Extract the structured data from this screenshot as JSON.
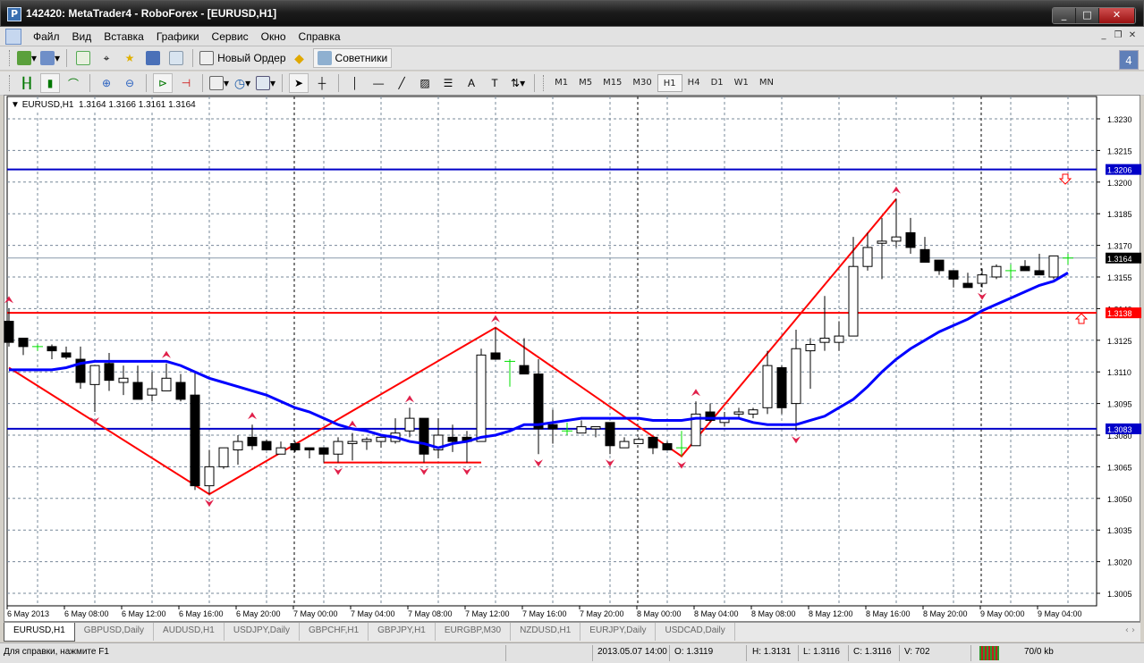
{
  "window": {
    "title": "142420: MetaTrader4 - RoboForex - [EURUSD,H1]",
    "app_icon": "P"
  },
  "menu": [
    "Файл",
    "Вид",
    "Вставка",
    "Графики",
    "Сервис",
    "Окно",
    "Справка"
  ],
  "toolbar": {
    "new_order": "Новый Ордер",
    "experts": "Советники",
    "notifications": "4"
  },
  "timeframes": [
    "M1",
    "M5",
    "M15",
    "M30",
    "H1",
    "H4",
    "D1",
    "W1",
    "MN"
  ],
  "active_timeframe": "H1",
  "chart": {
    "header": "EURUSD,H1  1.3164 1.3166 1.3161 1.3164",
    "colors": {
      "bull": "#ffffff",
      "bear": "#000000",
      "doji": "#00e000",
      "ma": "#0000ff",
      "zigzag": "#ff0000",
      "fractal": "#e0204a",
      "level_blue": "#0000c8",
      "level_red": "#ff0000",
      "bid": "#000000"
    }
  },
  "chart_data": {
    "type": "candlestick",
    "symbol": "EURUSD",
    "timeframe": "H1",
    "ylim": [
      1.2995,
      1.3241
    ],
    "price_ticks": [
      "1.3230",
      "1.3215",
      "1.3200",
      "1.3185",
      "1.3170",
      "1.3155",
      "1.3140",
      "1.3125",
      "1.3110",
      "1.3095",
      "1.3080",
      "1.3065",
      "1.3050",
      "1.3035",
      "1.3020",
      "1.3005"
    ],
    "time_labels": [
      "6 May 2013",
      "6 May 08:00",
      "6 May 12:00",
      "6 May 16:00",
      "6 May 20:00",
      "7 May 00:00",
      "7 May 04:00",
      "7 May 08:00",
      "7 May 12:00",
      "7 May 16:00",
      "7 May 20:00",
      "8 May 00:00",
      "8 May 04:00",
      "8 May 08:00",
      "8 May 12:00",
      "8 May 16:00",
      "8 May 20:00",
      "9 May 00:00",
      "9 May 04:00"
    ],
    "ohlc": [
      [
        1.3134,
        1.314,
        1.3122,
        1.3124
      ],
      [
        1.3126,
        1.3126,
        1.3118,
        1.3122
      ],
      [
        1.3122,
        1.3123,
        1.312,
        1.3122
      ],
      [
        1.3122,
        1.3123,
        1.3116,
        1.312
      ],
      [
        1.3119,
        1.3122,
        1.3116,
        1.3117
      ],
      [
        1.3116,
        1.3122,
        1.3102,
        1.3105
      ],
      [
        1.3104,
        1.3113,
        1.3091,
        1.3113
      ],
      [
        1.3114,
        1.3119,
        1.3101,
        1.3106
      ],
      [
        1.3105,
        1.3113,
        1.3099,
        1.3107
      ],
      [
        1.3105,
        1.3113,
        1.3097,
        1.3097
      ],
      [
        1.3099,
        1.311,
        1.3096,
        1.3102
      ],
      [
        1.3101,
        1.3114,
        1.3101,
        1.3107
      ],
      [
        1.3105,
        1.3109,
        1.3096,
        1.3097
      ],
      [
        1.3099,
        1.311,
        1.3054,
        1.3056
      ],
      [
        1.3056,
        1.3073,
        1.3052,
        1.3065
      ],
      [
        1.3065,
        1.3074,
        1.3064,
        1.3074
      ],
      [
        1.3073,
        1.308,
        1.3066,
        1.3077
      ],
      [
        1.3079,
        1.3085,
        1.3073,
        1.3075
      ],
      [
        1.3077,
        1.3078,
        1.3073,
        1.3073
      ],
      [
        1.3071,
        1.3077,
        1.3071,
        1.3074
      ],
      [
        1.3076,
        1.3077,
        1.3072,
        1.3073
      ],
      [
        1.3074,
        1.3074,
        1.3069,
        1.3073
      ],
      [
        1.3074,
        1.3074,
        1.3067,
        1.3071
      ],
      [
        1.3071,
        1.3079,
        1.3067,
        1.3077
      ],
      [
        1.3076,
        1.3081,
        1.3068,
        1.3077
      ],
      [
        1.3077,
        1.3079,
        1.3073,
        1.3078
      ],
      [
        1.3077,
        1.3079,
        1.3074,
        1.3079
      ],
      [
        1.3077,
        1.3088,
        1.3076,
        1.3081
      ],
      [
        1.3082,
        1.3093,
        1.3079,
        1.3088
      ],
      [
        1.3088,
        1.3088,
        1.3067,
        1.3071
      ],
      [
        1.3073,
        1.3088,
        1.3069,
        1.308
      ],
      [
        1.3079,
        1.3085,
        1.3072,
        1.3077
      ],
      [
        1.3079,
        1.3082,
        1.3067,
        1.3077
      ],
      [
        1.3077,
        1.3121,
        1.3077,
        1.3118
      ],
      [
        1.3119,
        1.3131,
        1.3116,
        1.3116
      ],
      [
        1.3115,
        1.3116,
        1.3103,
        1.3115
      ],
      [
        1.3113,
        1.3126,
        1.3109,
        1.3109
      ],
      [
        1.3109,
        1.3116,
        1.3071,
        1.3083
      ],
      [
        1.3085,
        1.3092,
        1.3076,
        1.3083
      ],
      [
        1.3082,
        1.3086,
        1.308,
        1.3082
      ],
      [
        1.3081,
        1.3087,
        1.3081,
        1.3084
      ],
      [
        1.3083,
        1.3084,
        1.3079,
        1.3084
      ],
      [
        1.3086,
        1.3086,
        1.3071,
        1.3075
      ],
      [
        1.3074,
        1.3079,
        1.3074,
        1.3077
      ],
      [
        1.3076,
        1.3079,
        1.3076,
        1.3078
      ],
      [
        1.3079,
        1.3079,
        1.3071,
        1.3074
      ],
      [
        1.3076,
        1.3077,
        1.3073,
        1.3073
      ],
      [
        1.3074,
        1.3082,
        1.307,
        1.3074
      ],
      [
        1.3075,
        1.3096,
        1.3075,
        1.309
      ],
      [
        1.3091,
        1.3095,
        1.3086,
        1.3087
      ],
      [
        1.3086,
        1.3091,
        1.3084,
        1.3088
      ],
      [
        1.309,
        1.3093,
        1.3088,
        1.3091
      ],
      [
        1.309,
        1.3093,
        1.3088,
        1.3092
      ],
      [
        1.3093,
        1.312,
        1.309,
        1.3113
      ],
      [
        1.3112,
        1.3113,
        1.309,
        1.3093
      ],
      [
        1.3095,
        1.313,
        1.3082,
        1.3121
      ],
      [
        1.312,
        1.3126,
        1.3102,
        1.3123
      ],
      [
        1.3124,
        1.3146,
        1.312,
        1.3126
      ],
      [
        1.3124,
        1.3134,
        1.312,
        1.3127
      ],
      [
        1.3127,
        1.3174,
        1.3127,
        1.316
      ],
      [
        1.316,
        1.3176,
        1.3158,
        1.3169
      ],
      [
        1.3171,
        1.3183,
        1.3154,
        1.3172
      ],
      [
        1.3172,
        1.3192,
        1.3169,
        1.3174
      ],
      [
        1.3176,
        1.3183,
        1.3166,
        1.3169
      ],
      [
        1.3168,
        1.3174,
        1.3162,
        1.3162
      ],
      [
        1.3163,
        1.3163,
        1.3156,
        1.3158
      ],
      [
        1.3158,
        1.3158,
        1.315,
        1.3154
      ],
      [
        1.3152,
        1.3157,
        1.315,
        1.315
      ],
      [
        1.3152,
        1.3159,
        1.315,
        1.3156
      ],
      [
        1.3155,
        1.3161,
        1.3154,
        1.316
      ],
      [
        1.3158,
        1.3161,
        1.3154,
        1.3158
      ],
      [
        1.316,
        1.3163,
        1.3158,
        1.3158
      ],
      [
        1.3158,
        1.3166,
        1.3156,
        1.3156
      ],
      [
        1.3155,
        1.3165,
        1.3154,
        1.3165
      ],
      [
        1.3164,
        1.3166,
        1.3161,
        1.3164
      ]
    ],
    "moving_average": [
      1.3111,
      1.3111,
      1.3111,
      1.3111,
      1.3112,
      1.3114,
      1.3115,
      1.3115,
      1.3115,
      1.3115,
      1.3115,
      1.3115,
      1.3113,
      1.311,
      1.3107,
      1.3105,
      1.3103,
      1.3101,
      1.3099,
      1.3096,
      1.3093,
      1.3091,
      1.3088,
      1.3085,
      1.3083,
      1.3082,
      1.308,
      1.3079,
      1.3077,
      1.3076,
      1.3074,
      1.3076,
      1.3077,
      1.3079,
      1.308,
      1.3082,
      1.3085,
      1.3085,
      1.3086,
      1.3087,
      1.3088,
      1.3088,
      1.3088,
      1.3088,
      1.3088,
      1.3087,
      1.3087,
      1.3087,
      1.3088,
      1.3088,
      1.3088,
      1.3088,
      1.3086,
      1.3085,
      1.3085,
      1.3085,
      1.3087,
      1.3089,
      1.3093,
      1.3097,
      1.3103,
      1.311,
      1.3116,
      1.3121,
      1.3125,
      1.3129,
      1.3132,
      1.3135,
      1.3139,
      1.3142,
      1.3145,
      1.3148,
      1.3151,
      1.3153,
      1.3157
    ],
    "zigzag": [
      [
        0,
        1.3112
      ],
      [
        14,
        1.3052
      ],
      [
        34,
        1.3131
      ],
      [
        47,
        1.307
      ],
      [
        62,
        1.3192
      ]
    ],
    "fractals_up": [
      0,
      11,
      17,
      24,
      28,
      34,
      48,
      62
    ],
    "fractals_down": [
      6,
      14,
      23,
      29,
      32,
      37,
      42,
      47,
      55,
      68
    ],
    "support_segment": {
      "from": 22,
      "to": 33,
      "price": 1.3067
    },
    "levels": [
      {
        "price": "1.3206",
        "color": "#0000c8"
      },
      {
        "price": "1.3083",
        "color": "#0000c8"
      },
      {
        "price": "1.3138",
        "color": "#ff0000"
      },
      {
        "price": "1.3164",
        "color": "#000000"
      }
    ],
    "day_separators": [
      20,
      44,
      68
    ]
  },
  "tabs": [
    "EURUSD,H1",
    "GBPUSD,Daily",
    "AUDUSD,H1",
    "USDJPY,Daily",
    "GBPCHF,H1",
    "GBPJPY,H1",
    "EURGBP,M30",
    "NZDUSD,H1",
    "EURJPY,Daily",
    "USDCAD,Daily"
  ],
  "status": {
    "help": "Для справки, нажмите F1",
    "datetime": "2013.05.07 14:00",
    "open": "O: 1.3119",
    "high": "H: 1.3131",
    "low": "L: 1.3116",
    "close": "C: 1.3116",
    "volume": "V: 702",
    "traffic": "70/0 kb"
  }
}
